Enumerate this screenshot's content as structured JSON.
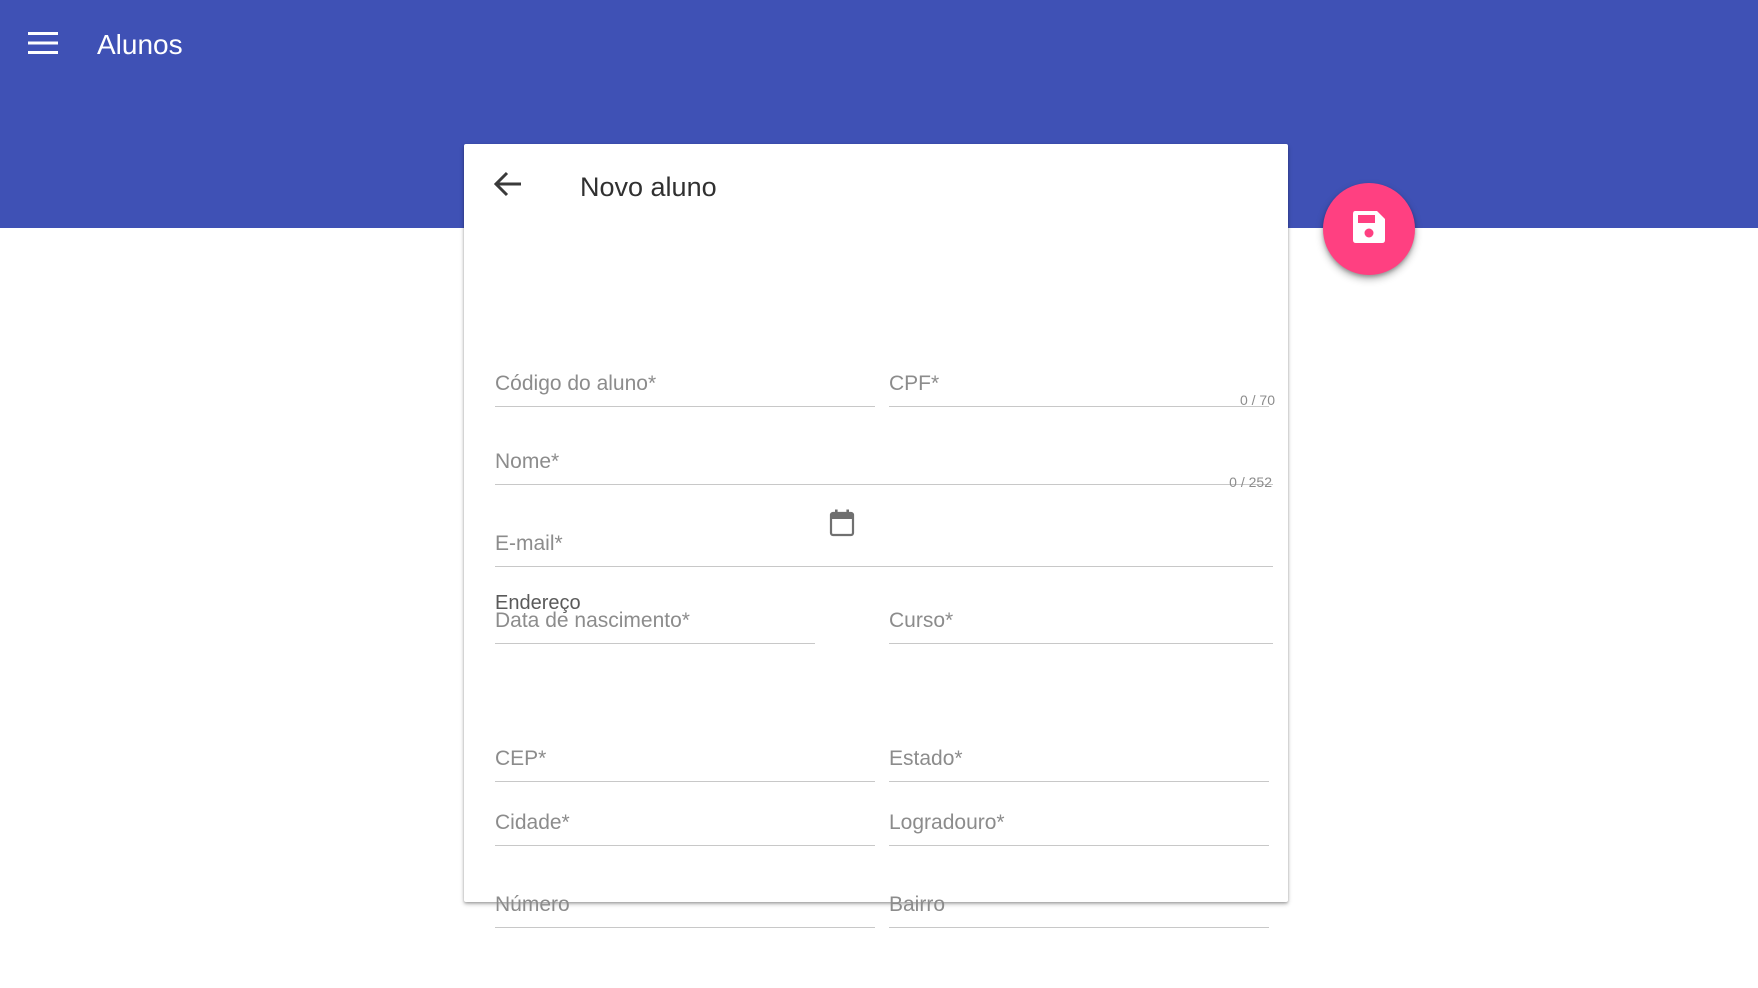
{
  "app_bar": {
    "title": "Alunos",
    "menu_icon": "menu-icon",
    "color": "#3f51b5"
  },
  "form": {
    "title": "Novo aluno",
    "back_icon": "arrow-back-icon",
    "fields": {
      "codigo": "Código do aluno*",
      "cpf": "CPF*",
      "nome": "Nome*",
      "nome_counter": "0 / 70",
      "email": "E-mail*",
      "email_counter": "0 / 252",
      "data_nascimento": "Data de nascimento*",
      "curso": "Curso*"
    },
    "calendar_icon": "calendar-icon",
    "address": {
      "section_label": "Endereço",
      "cep": "CEP*",
      "estado": "Estado*",
      "cidade": "Cidade*",
      "logradouro": "Logradouro*",
      "numero": "Número",
      "bairro": "Bairro"
    }
  },
  "fab": {
    "icon": "save-icon",
    "color": "#ff4081"
  }
}
